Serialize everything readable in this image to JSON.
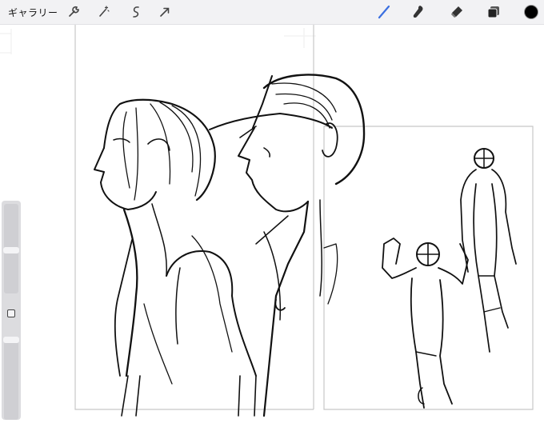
{
  "toolbar": {
    "gallery_label": "ギャラリー",
    "left_tools": [
      "wrench-icon",
      "magic-wand-icon",
      "selection-icon",
      "transform-arrow-icon"
    ],
    "right_tools": [
      "brush-icon",
      "smudge-icon",
      "eraser-icon",
      "layers-icon"
    ],
    "active_tool": "brush-icon",
    "active_tool_color": "#3b6fe0",
    "current_color": "#000000"
  },
  "sidebar": {
    "controls": [
      "brush-size-slider",
      "modify-button",
      "opacity-slider"
    ]
  },
  "canvas": {
    "content": "sketch",
    "panel_border_color": "#c8c8c8",
    "stroke_color": "#111111"
  }
}
